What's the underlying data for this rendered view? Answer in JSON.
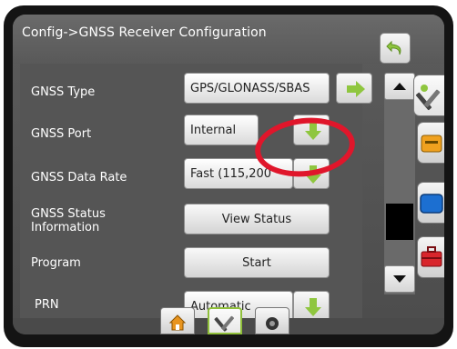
{
  "header": {
    "title": "Config->GNSS Receiver Configuration"
  },
  "rows": {
    "gnss_type": {
      "label": "GNSS Type",
      "value": "GPS/GLONASS/SBAS"
    },
    "gnss_port": {
      "label": "GNSS Port",
      "value": "Internal"
    },
    "data_rate": {
      "label": "GNSS Data Rate",
      "value": "Fast (115,200"
    },
    "status_info": {
      "label_line1": "GNSS Status",
      "label_line2": "Information",
      "button": "View Status"
    },
    "program": {
      "label": "Program",
      "button": "Start"
    },
    "prn": {
      "label": "PRN",
      "value": "Automatic"
    }
  },
  "icons": {
    "back": "undo-arrow-icon",
    "arrow_right": "green-arrow-right-icon",
    "arrow_down": "green-arrow-down-icon",
    "scroll_up": "triangle-up-icon",
    "scroll_down": "triangle-down-icon",
    "side_tabs": [
      "tools-icon",
      "console-icon",
      "display-icon",
      "toolbox-icon"
    ],
    "bottom_tabs": [
      "home-icon",
      "tools-icon",
      "camera-icon"
    ]
  },
  "colors": {
    "accent_green": "#8fc63f",
    "highlight_red": "#e0162b",
    "header_bg": "#626262",
    "panel_bg": "#555555"
  }
}
